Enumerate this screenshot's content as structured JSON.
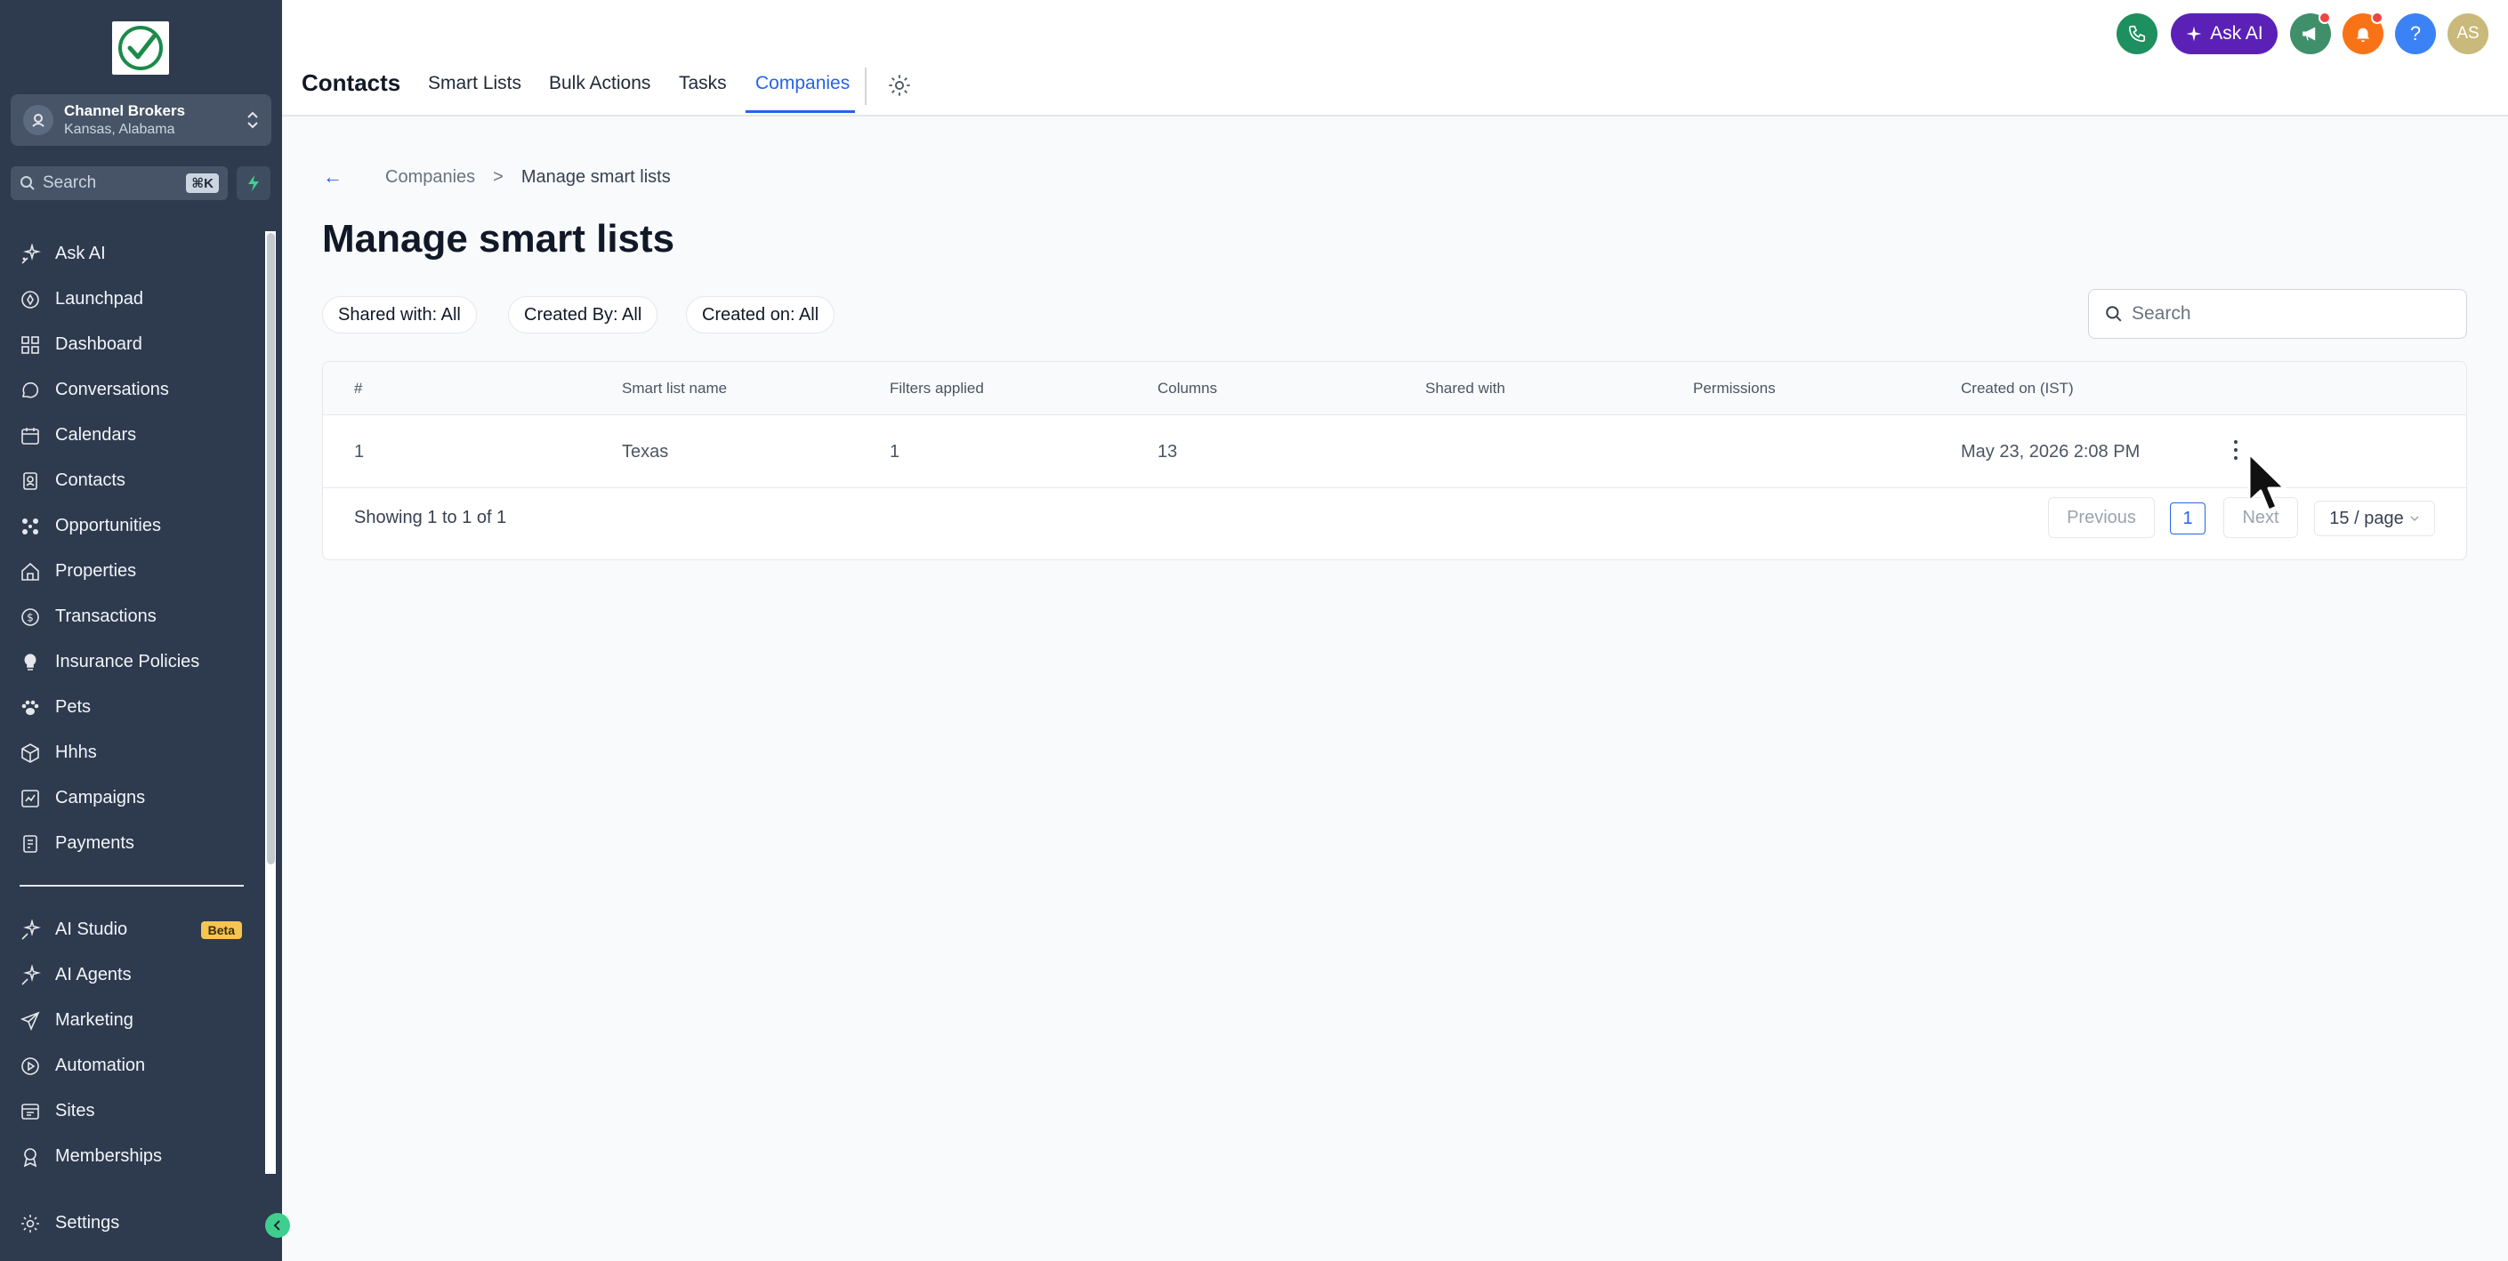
{
  "sidebar": {
    "account": {
      "name": "Channel Brokers",
      "location": "Kansas, Alabama"
    },
    "search": {
      "placeholder": "Search",
      "shortcut": "⌘K"
    },
    "items": [
      {
        "label": "Ask AI",
        "icon": "sparkle-icon"
      },
      {
        "label": "Launchpad",
        "icon": "rocket-icon"
      },
      {
        "label": "Dashboard",
        "icon": "grid-icon"
      },
      {
        "label": "Conversations",
        "icon": "chat-icon"
      },
      {
        "label": "Calendars",
        "icon": "calendar-icon"
      },
      {
        "label": "Contacts",
        "icon": "contacts-icon"
      },
      {
        "label": "Opportunities",
        "icon": "opportunities-icon"
      },
      {
        "label": "Properties",
        "icon": "house-icon"
      },
      {
        "label": "Transactions",
        "icon": "dollar-icon"
      },
      {
        "label": "Insurance Policies",
        "icon": "lightbulb-icon"
      },
      {
        "label": "Pets",
        "icon": "paw-icon"
      },
      {
        "label": "Hhhs",
        "icon": "cube-icon"
      },
      {
        "label": "Campaigns",
        "icon": "campaign-icon"
      },
      {
        "label": "Payments",
        "icon": "payments-icon"
      }
    ],
    "items2": [
      {
        "label": "AI Studio",
        "icon": "sparkle-icon",
        "badge": "Beta"
      },
      {
        "label": "AI Agents",
        "icon": "sparkle-icon"
      },
      {
        "label": "Marketing",
        "icon": "send-icon"
      },
      {
        "label": "Automation",
        "icon": "automation-icon"
      },
      {
        "label": "Sites",
        "icon": "sites-icon"
      },
      {
        "label": "Memberships",
        "icon": "award-icon"
      }
    ],
    "settings": {
      "label": "Settings",
      "icon": "gear-icon"
    }
  },
  "topbar": {
    "page_name": "Contacts",
    "tabs": [
      {
        "label": "Smart Lists"
      },
      {
        "label": "Bulk Actions"
      },
      {
        "label": "Tasks"
      },
      {
        "label": "Companies",
        "active": true
      }
    ],
    "ask_ai_label": "Ask AI",
    "avatar_initials": "AS",
    "help_label": "?",
    "colors": {
      "phone": "#1e8f5e",
      "ask_ai": "#5b21b6",
      "megaphone": "#3f8f6b",
      "bell": "#f97316",
      "help": "#3b82f6",
      "avatar": "#c9b97a"
    }
  },
  "main": {
    "breadcrumb": {
      "back": "←",
      "parent": "Companies",
      "separator": ">",
      "current": "Manage smart lists"
    },
    "title": "Manage smart lists",
    "filters": [
      "Shared with: All",
      "Created By: All",
      "Created on: All"
    ],
    "search_placeholder": "Search",
    "table": {
      "columns": [
        "#",
        "Smart list name",
        "Filters applied",
        "Columns",
        "Shared with",
        "Permissions",
        "Created on (IST)"
      ],
      "rows": [
        {
          "num": "1",
          "name": "Texas",
          "filters": "1",
          "columns": "13",
          "shared": "",
          "permissions": "",
          "created": "May 23, 2026 2:08 PM"
        }
      ]
    },
    "pagination": {
      "showing": "Showing 1 to 1 of 1",
      "previous": "Previous",
      "page": "1",
      "next": "Next",
      "per_page": "15 / page"
    }
  }
}
